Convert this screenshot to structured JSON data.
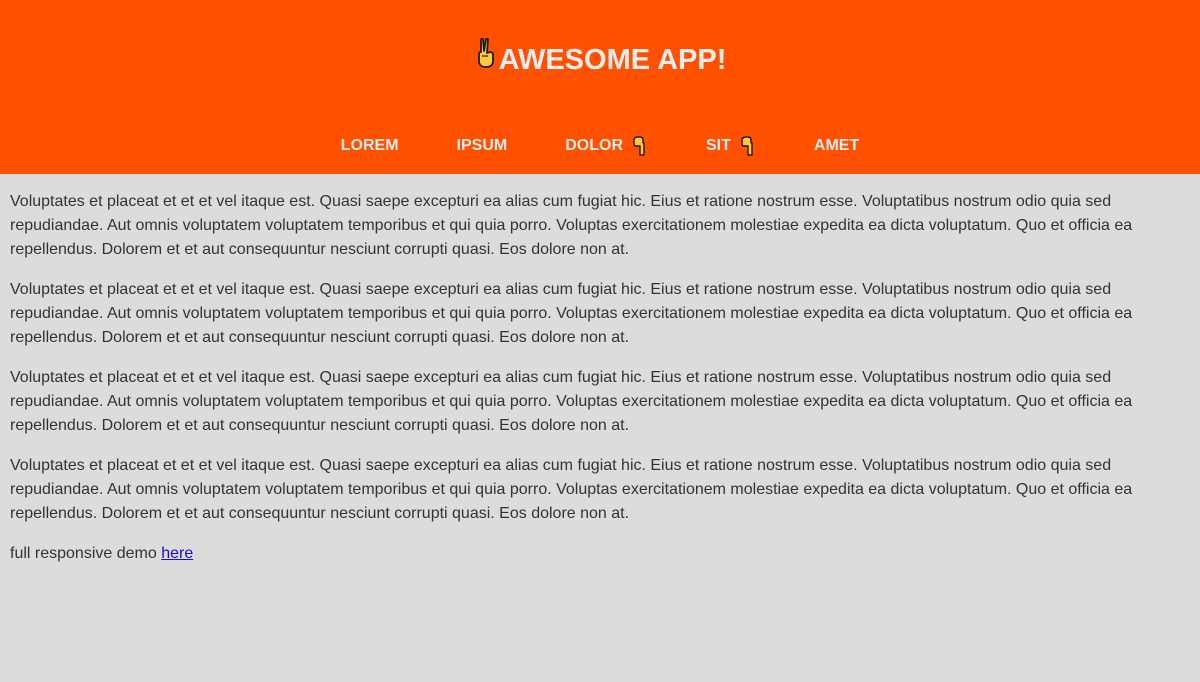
{
  "header": {
    "title": "AWESOME APP!",
    "title_icon": "victory-hand-icon",
    "background_color": "#ff5100",
    "text_color": "#ececec"
  },
  "nav": {
    "items": [
      {
        "label": "LOREM",
        "icon": null
      },
      {
        "label": "IPSUM",
        "icon": null
      },
      {
        "label": "DOLOR",
        "icon": "pointing-down-hand-icon"
      },
      {
        "label": "SIT",
        "icon": "pointing-down-hand-icon"
      },
      {
        "label": "AMET",
        "icon": null
      }
    ]
  },
  "main": {
    "paragraphs": [
      "Voluptates et placeat et et et vel itaque est. Quasi saepe excepturi ea alias cum fugiat hic. Eius et ratione nostrum esse. Voluptatibus nostrum odio quia sed repudiandae. Aut omnis voluptatem voluptatem temporibus et qui quia porro. Voluptas exercitationem molestiae expedita ea dicta voluptatum. Quo et officia ea repellendus. Dolorem et et aut consequuntur nesciunt corrupti quasi. Eos dolore non at.",
      "Voluptates et placeat et et et vel itaque est. Quasi saepe excepturi ea alias cum fugiat hic. Eius et ratione nostrum esse. Voluptatibus nostrum odio quia sed repudiandae. Aut omnis voluptatem voluptatem temporibus et qui quia porro. Voluptas exercitationem molestiae expedita ea dicta voluptatum. Quo et officia ea repellendus. Dolorem et et aut consequuntur nesciunt corrupti quasi. Eos dolore non at.",
      "Voluptates et placeat et et et vel itaque est. Quasi saepe excepturi ea alias cum fugiat hic. Eius et ratione nostrum esse. Voluptatibus nostrum odio quia sed repudiandae. Aut omnis voluptatem voluptatem temporibus et qui quia porro. Voluptas exercitationem molestiae expedita ea dicta voluptatum. Quo et officia ea repellendus. Dolorem et et aut consequuntur nesciunt corrupti quasi. Eos dolore non at.",
      "Voluptates et placeat et et et vel itaque est. Quasi saepe excepturi ea alias cum fugiat hic. Eius et ratione nostrum esse. Voluptatibus nostrum odio quia sed repudiandae. Aut omnis voluptatem voluptatem temporibus et qui quia porro. Voluptas exercitationem molestiae expedita ea dicta voluptatum. Quo et officia ea repellendus. Dolorem et et aut consequuntur nesciunt corrupti quasi. Eos dolore non at."
    ],
    "footer_text": "full responsive demo",
    "footer_link": "here",
    "link_color": "#1a0dcc",
    "background_color": "#dcdcdc"
  }
}
